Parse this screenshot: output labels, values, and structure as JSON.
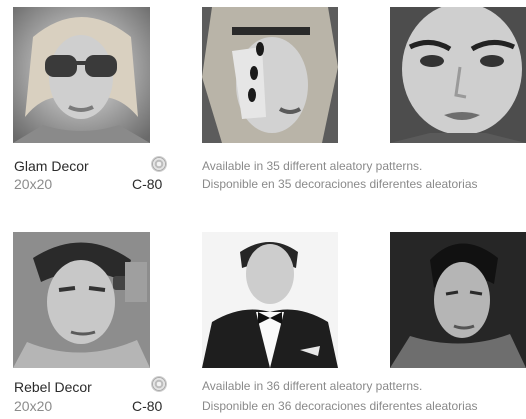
{
  "sections": [
    {
      "name": "Glam Decor",
      "size": "20x20",
      "code": "C-80",
      "swatch_icon": "tile-swatch-icon",
      "available_en": "Available in 35 different aleatory patterns.",
      "available_es": "Disponible en 35 decoraciones diferentes aleatorias",
      "photos": [
        "woman-sunglasses",
        "woman-hand-over-face",
        "woman-closeup-face"
      ]
    },
    {
      "name": "Rebel Decor",
      "size": "20x20",
      "code": "C-80",
      "swatch_icon": "tile-swatch-icon",
      "available_en": "Available in 36 different aleatory patterns.",
      "available_es": "Disponible en 36 decoraciones diferentes aleatorias",
      "photos": [
        "man-bare-shoulders-watch",
        "man-tuxedo-bowtie",
        "man-dark-hair"
      ]
    }
  ]
}
